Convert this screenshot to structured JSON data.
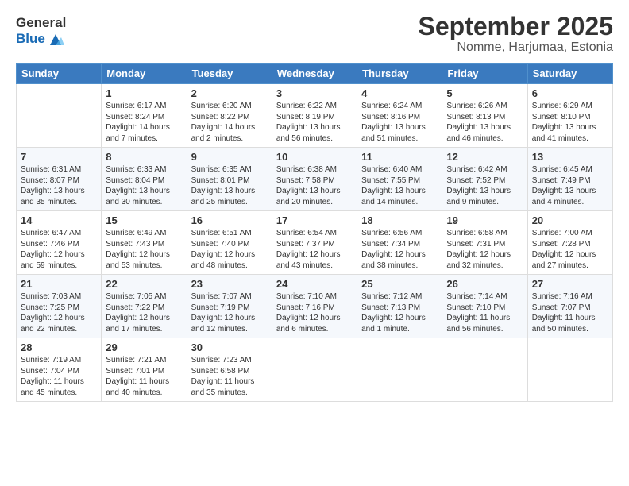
{
  "logo": {
    "general": "General",
    "blue": "Blue"
  },
  "title": "September 2025",
  "location": "Nomme, Harjumaa, Estonia",
  "days": [
    "Sunday",
    "Monday",
    "Tuesday",
    "Wednesday",
    "Thursday",
    "Friday",
    "Saturday"
  ],
  "weeks": [
    [
      {
        "day": "",
        "info": ""
      },
      {
        "day": "1",
        "info": "Sunrise: 6:17 AM\nSunset: 8:24 PM\nDaylight: 14 hours\nand 7 minutes."
      },
      {
        "day": "2",
        "info": "Sunrise: 6:20 AM\nSunset: 8:22 PM\nDaylight: 14 hours\nand 2 minutes."
      },
      {
        "day": "3",
        "info": "Sunrise: 6:22 AM\nSunset: 8:19 PM\nDaylight: 13 hours\nand 56 minutes."
      },
      {
        "day": "4",
        "info": "Sunrise: 6:24 AM\nSunset: 8:16 PM\nDaylight: 13 hours\nand 51 minutes."
      },
      {
        "day": "5",
        "info": "Sunrise: 6:26 AM\nSunset: 8:13 PM\nDaylight: 13 hours\nand 46 minutes."
      },
      {
        "day": "6",
        "info": "Sunrise: 6:29 AM\nSunset: 8:10 PM\nDaylight: 13 hours\nand 41 minutes."
      }
    ],
    [
      {
        "day": "7",
        "info": "Sunrise: 6:31 AM\nSunset: 8:07 PM\nDaylight: 13 hours\nand 35 minutes."
      },
      {
        "day": "8",
        "info": "Sunrise: 6:33 AM\nSunset: 8:04 PM\nDaylight: 13 hours\nand 30 minutes."
      },
      {
        "day": "9",
        "info": "Sunrise: 6:35 AM\nSunset: 8:01 PM\nDaylight: 13 hours\nand 25 minutes."
      },
      {
        "day": "10",
        "info": "Sunrise: 6:38 AM\nSunset: 7:58 PM\nDaylight: 13 hours\nand 20 minutes."
      },
      {
        "day": "11",
        "info": "Sunrise: 6:40 AM\nSunset: 7:55 PM\nDaylight: 13 hours\nand 14 minutes."
      },
      {
        "day": "12",
        "info": "Sunrise: 6:42 AM\nSunset: 7:52 PM\nDaylight: 13 hours\nand 9 minutes."
      },
      {
        "day": "13",
        "info": "Sunrise: 6:45 AM\nSunset: 7:49 PM\nDaylight: 13 hours\nand 4 minutes."
      }
    ],
    [
      {
        "day": "14",
        "info": "Sunrise: 6:47 AM\nSunset: 7:46 PM\nDaylight: 12 hours\nand 59 minutes."
      },
      {
        "day": "15",
        "info": "Sunrise: 6:49 AM\nSunset: 7:43 PM\nDaylight: 12 hours\nand 53 minutes."
      },
      {
        "day": "16",
        "info": "Sunrise: 6:51 AM\nSunset: 7:40 PM\nDaylight: 12 hours\nand 48 minutes."
      },
      {
        "day": "17",
        "info": "Sunrise: 6:54 AM\nSunset: 7:37 PM\nDaylight: 12 hours\nand 43 minutes."
      },
      {
        "day": "18",
        "info": "Sunrise: 6:56 AM\nSunset: 7:34 PM\nDaylight: 12 hours\nand 38 minutes."
      },
      {
        "day": "19",
        "info": "Sunrise: 6:58 AM\nSunset: 7:31 PM\nDaylight: 12 hours\nand 32 minutes."
      },
      {
        "day": "20",
        "info": "Sunrise: 7:00 AM\nSunset: 7:28 PM\nDaylight: 12 hours\nand 27 minutes."
      }
    ],
    [
      {
        "day": "21",
        "info": "Sunrise: 7:03 AM\nSunset: 7:25 PM\nDaylight: 12 hours\nand 22 minutes."
      },
      {
        "day": "22",
        "info": "Sunrise: 7:05 AM\nSunset: 7:22 PM\nDaylight: 12 hours\nand 17 minutes."
      },
      {
        "day": "23",
        "info": "Sunrise: 7:07 AM\nSunset: 7:19 PM\nDaylight: 12 hours\nand 12 minutes."
      },
      {
        "day": "24",
        "info": "Sunrise: 7:10 AM\nSunset: 7:16 PM\nDaylight: 12 hours\nand 6 minutes."
      },
      {
        "day": "25",
        "info": "Sunrise: 7:12 AM\nSunset: 7:13 PM\nDaylight: 12 hours\nand 1 minute."
      },
      {
        "day": "26",
        "info": "Sunrise: 7:14 AM\nSunset: 7:10 PM\nDaylight: 11 hours\nand 56 minutes."
      },
      {
        "day": "27",
        "info": "Sunrise: 7:16 AM\nSunset: 7:07 PM\nDaylight: 11 hours\nand 50 minutes."
      }
    ],
    [
      {
        "day": "28",
        "info": "Sunrise: 7:19 AM\nSunset: 7:04 PM\nDaylight: 11 hours\nand 45 minutes."
      },
      {
        "day": "29",
        "info": "Sunrise: 7:21 AM\nSunset: 7:01 PM\nDaylight: 11 hours\nand 40 minutes."
      },
      {
        "day": "30",
        "info": "Sunrise: 7:23 AM\nSunset: 6:58 PM\nDaylight: 11 hours\nand 35 minutes."
      },
      {
        "day": "",
        "info": ""
      },
      {
        "day": "",
        "info": ""
      },
      {
        "day": "",
        "info": ""
      },
      {
        "day": "",
        "info": ""
      }
    ]
  ]
}
